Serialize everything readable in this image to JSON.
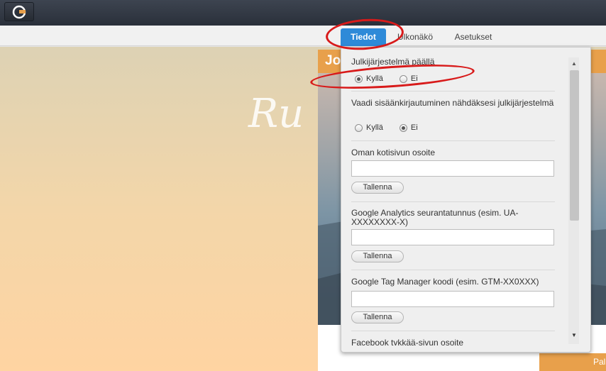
{
  "tabs": [
    "Tiedot",
    "Ulkonäkö",
    "Asetukset"
  ],
  "site": {
    "header_text": "Jo",
    "hero_script": "Ru",
    "cta_label": "Pal"
  },
  "panel": {
    "sections": [
      {
        "title": "Julkijärjestelmä päällä",
        "options": [
          {
            "label": "Kyllä",
            "checked": true
          },
          {
            "label": "Ei",
            "checked": false
          }
        ]
      },
      {
        "title": "Vaadi sisäänkirjautuminen nähdäksesi julkijärjestelmä",
        "options": [
          {
            "label": "Kyllä",
            "checked": false
          },
          {
            "label": "Ei",
            "checked": true
          }
        ]
      },
      {
        "title": "Oman kotisivun osoite",
        "input_value": "",
        "button": "Tallenna"
      },
      {
        "title": "Google Analytics seurantatunnus (esim. UA-XXXXXXXX-X)",
        "input_value": "",
        "button": "Tallenna"
      },
      {
        "title": "Google Tag Manager koodi (esim. GTM-XX0XXX)",
        "input_value": "",
        "button": "Tallenna"
      },
      {
        "title": "Facebook tykkää-sivun osoite"
      }
    ]
  },
  "colors": {
    "accent": "#2e8ad8",
    "highlight_ring": "#d81a1a",
    "site_orange": "#e8a04b"
  },
  "icons": {
    "logo": "app-logo-icon",
    "scroll_up": "triangle-up-icon",
    "scroll_down": "triangle-down-icon"
  }
}
